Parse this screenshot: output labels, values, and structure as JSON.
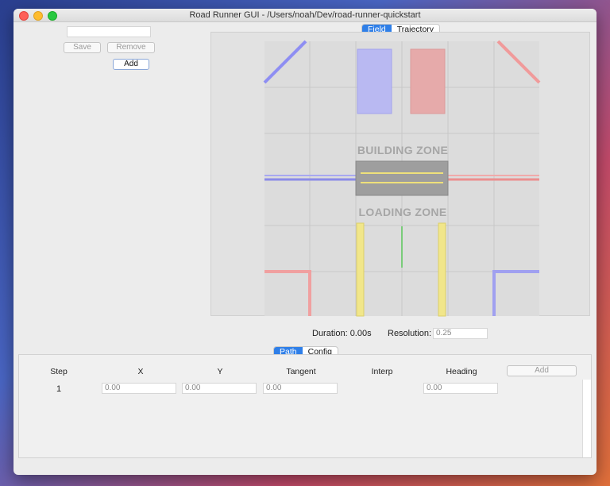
{
  "window": {
    "title": "Road Runner GUI - /Users/noah/Dev/road-runner-quickstart"
  },
  "left_panel": {
    "name_value": "",
    "save_label": "Save",
    "remove_label": "Remove",
    "add_label": "Add"
  },
  "view_tabs": [
    {
      "label": "Field",
      "selected": true
    },
    {
      "label": "Trajectory",
      "selected": false
    }
  ],
  "field": {
    "building_zone_label": "BUILDING ZONE",
    "loading_zone_label": "LOADING ZONE",
    "colors": {
      "blue": "#4b4bff",
      "red": "#ff5a5a",
      "yellow": "#f2e04a",
      "green": "#2ec42e"
    }
  },
  "status": {
    "duration_text": "Duration: 0.00s",
    "resolution_label": "Resolution:",
    "resolution_value": "0.25"
  },
  "editor_tabs": [
    {
      "label": "Path",
      "selected": true
    },
    {
      "label": "Config",
      "selected": false
    }
  ],
  "table": {
    "headers": [
      "Step",
      "X",
      "Y",
      "Tangent",
      "Interp",
      "Heading"
    ],
    "add_label": "Add",
    "rows": [
      {
        "step": "1",
        "x": "0.00",
        "y": "0.00",
        "tangent": "0.00",
        "interp": "",
        "heading": "0.00"
      }
    ]
  }
}
